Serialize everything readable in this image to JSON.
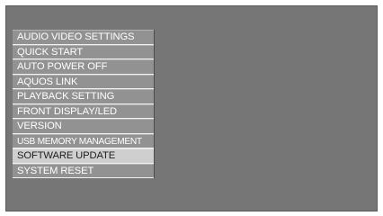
{
  "menu": {
    "items": [
      {
        "label": "AUDIO VIDEO SETTINGS"
      },
      {
        "label": "QUICK START"
      },
      {
        "label": "AUTO POWER OFF"
      },
      {
        "label": "AQUOS LINK"
      },
      {
        "label": "PLAYBACK SETTING"
      },
      {
        "label": "FRONT DISPLAY/LED"
      },
      {
        "label": "VERSION"
      },
      {
        "label": "USB MEMORY MANAGEMENT"
      },
      {
        "label": "SOFTWARE UPDATE"
      },
      {
        "label": "SYSTEM RESET"
      }
    ],
    "selected_label": "SOFTWARE UPDATE"
  },
  "colors": {
    "screen_background": "#767676",
    "item_background": "#929292",
    "selected_background": "#cfcfcf"
  }
}
